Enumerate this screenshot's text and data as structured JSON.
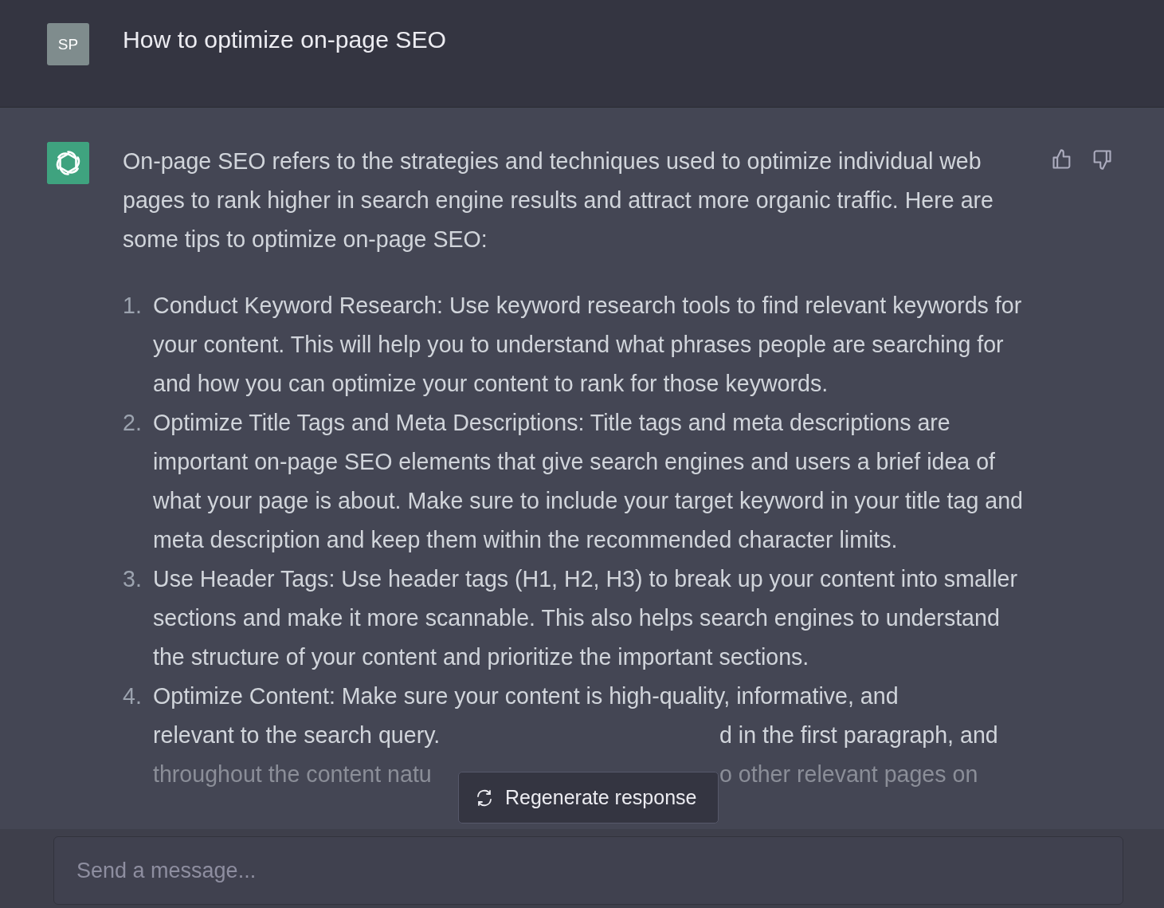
{
  "header": {
    "avatar": "SP",
    "title": "How to optimize on-page SEO"
  },
  "response": {
    "intro": "On-page SEO refers to the strategies and techniques used to optimize individual web pages to rank higher in search engine results and attract more organic traffic. Here are some tips to optimize on-page SEO:",
    "items": [
      {
        "kind": "text",
        "number": "1.",
        "text": "Conduct Keyword Research: Use keyword research tools to find relevant keywords for your content. This will help you to understand what phrases people are searching for and how you can optimize your content to rank for those keywords."
      },
      {
        "kind": "text",
        "number": "2.",
        "text": "Optimize Title Tags and Meta Descriptions: Title tags and meta descriptions are important on-page SEO elements that give search engines and users a brief idea of what your page is about. Make sure to include your target keyword in your title tag and meta description and keep them within the recommended character limits."
      },
      {
        "kind": "text",
        "number": "3.",
        "text": "Use Header Tags: Use header tags (H1, H2, H3) to break up your content into smaller sections and make it more scannable. This also helps search engines to understand the structure of your content and prioritize the important sections."
      },
      {
        "kind": "lines",
        "number": "4.",
        "lines": [
          {
            "left": "Optimize Content: Make sure your content is high-quality, informative, and"
          },
          {
            "left": "relevant to the search query.",
            "right": "d in the first paragraph, and"
          },
          {
            "left": "throughout the content natu",
            "right": "o other relevant pages on"
          }
        ]
      }
    ]
  },
  "regenerate_button": "Regenerate response",
  "message_field": {
    "placeholder": "Send a message..."
  }
}
